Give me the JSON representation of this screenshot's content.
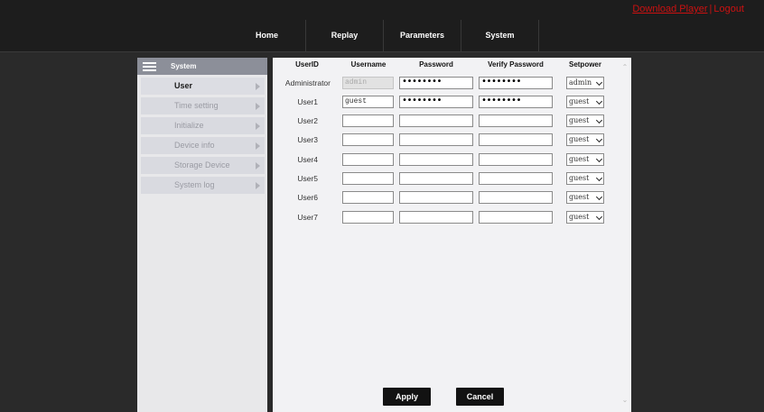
{
  "header": {
    "download_label": "Download Player",
    "separator": "|",
    "logout_label": "Logout",
    "nav": [
      "Home",
      "Replay",
      "Parameters",
      "System"
    ]
  },
  "sidebar": {
    "title": "System",
    "items": [
      {
        "label": "User",
        "active": true
      },
      {
        "label": "Time setting"
      },
      {
        "label": "Initialize"
      },
      {
        "label": "Device info"
      },
      {
        "label": "Storage Device"
      },
      {
        "label": "System log"
      }
    ]
  },
  "table": {
    "headers": [
      "UserID",
      "Username",
      "Password",
      "Verify Password",
      "Setpower"
    ],
    "rows": [
      {
        "id": "Administrator",
        "username": "admin",
        "password": "••••••••",
        "verify": "••••••••",
        "power": "admin"
      },
      {
        "id": "User1",
        "username": "guest",
        "password": "••••••••",
        "verify": "••••••••",
        "power": "guest"
      },
      {
        "id": "User2",
        "username": "",
        "password": "",
        "verify": "",
        "power": "guest"
      },
      {
        "id": "User3",
        "username": "",
        "password": "",
        "verify": "",
        "power": "guest"
      },
      {
        "id": "User4",
        "username": "",
        "password": "",
        "verify": "",
        "power": "guest"
      },
      {
        "id": "User5",
        "username": "",
        "password": "",
        "verify": "",
        "power": "guest"
      },
      {
        "id": "User6",
        "username": "",
        "password": "",
        "verify": "",
        "power": "guest"
      },
      {
        "id": "User7",
        "username": "",
        "password": "",
        "verify": "",
        "power": "guest"
      }
    ]
  },
  "actions": {
    "apply_label": "Apply",
    "cancel_label": "Cancel"
  },
  "colors": {
    "link_red": "#cc1111",
    "header_bg": "#1d1d1d",
    "page_bg": "#2a2a2a",
    "sidebar_head": "#8c8f99",
    "button_bg": "#121212"
  }
}
